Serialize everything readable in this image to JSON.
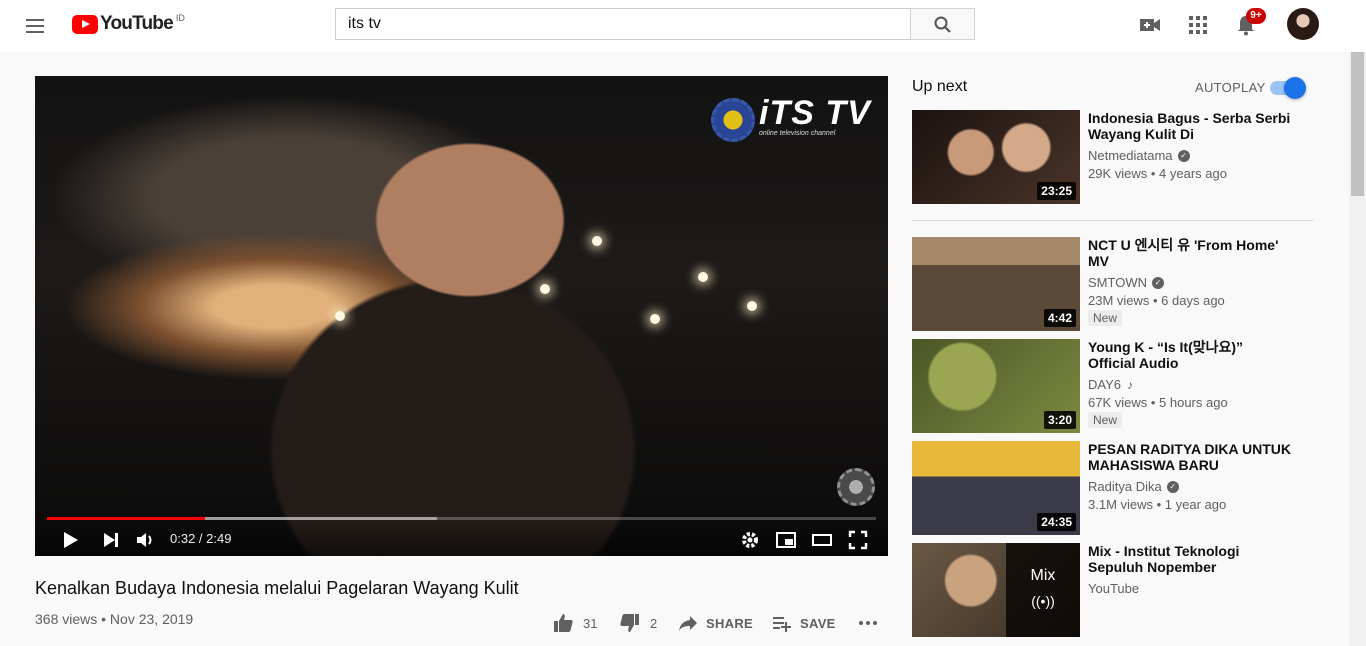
{
  "header": {
    "logo_text": "YouTube",
    "country_code": "ID",
    "search_value": "its tv",
    "notification_count": "9+"
  },
  "player": {
    "watermark_title": "iTS TV",
    "watermark_subtitle": "online television channel",
    "time_display": "0:32 / 2:49",
    "progress_played_fraction": 0.19,
    "progress_loaded_fraction": 0.47
  },
  "video": {
    "title": "Kenalkan Budaya Indonesia melalui Pagelaran Wayang Kulit",
    "meta": "368 views • Nov 23, 2019",
    "likes": "31",
    "dislikes": "2",
    "share_label": "SHARE",
    "save_label": "SAVE"
  },
  "sidebar": {
    "up_next_label": "Up next",
    "autoplay_label": "AUTOPLAY",
    "autoplay_on": true,
    "items": [
      {
        "title": "Indonesia Bagus - Serba Serbi Wayang Kulit Di Karanganyar,...",
        "channel": "Netmediatama",
        "verified": true,
        "stats": "29K views • 4 years ago",
        "duration": "23:25",
        "thumb_color": "#3b2a22"
      },
      {
        "title": "NCT U 엔시티 유 'From Home' MV",
        "channel": "SMTOWN",
        "verified": true,
        "stats": "23M views • 6 days ago",
        "badge": "New",
        "duration": "4:42",
        "thumb_color": "#6b5a45"
      },
      {
        "title": "Young K - “Is It(맞나요)” Official Audio",
        "channel": "DAY6",
        "music_note": "♪",
        "stats": "67K views • 5 hours ago",
        "badge": "New",
        "duration": "3:20",
        "thumb_color": "#6f7a3c"
      },
      {
        "title": "PESAN RADITYA DIKA UNTUK MAHASISWA BARU",
        "channel": "Raditya Dika",
        "verified": true,
        "stats": "3.1M views • 1 year ago",
        "duration": "24:35",
        "thumb_color": "#c9932c"
      },
      {
        "title": "Mix - Institut Teknologi Sepuluh Nopember",
        "channel": "YouTube",
        "mix_label": "Mix",
        "thumb_color": "#7a6a55"
      }
    ]
  }
}
